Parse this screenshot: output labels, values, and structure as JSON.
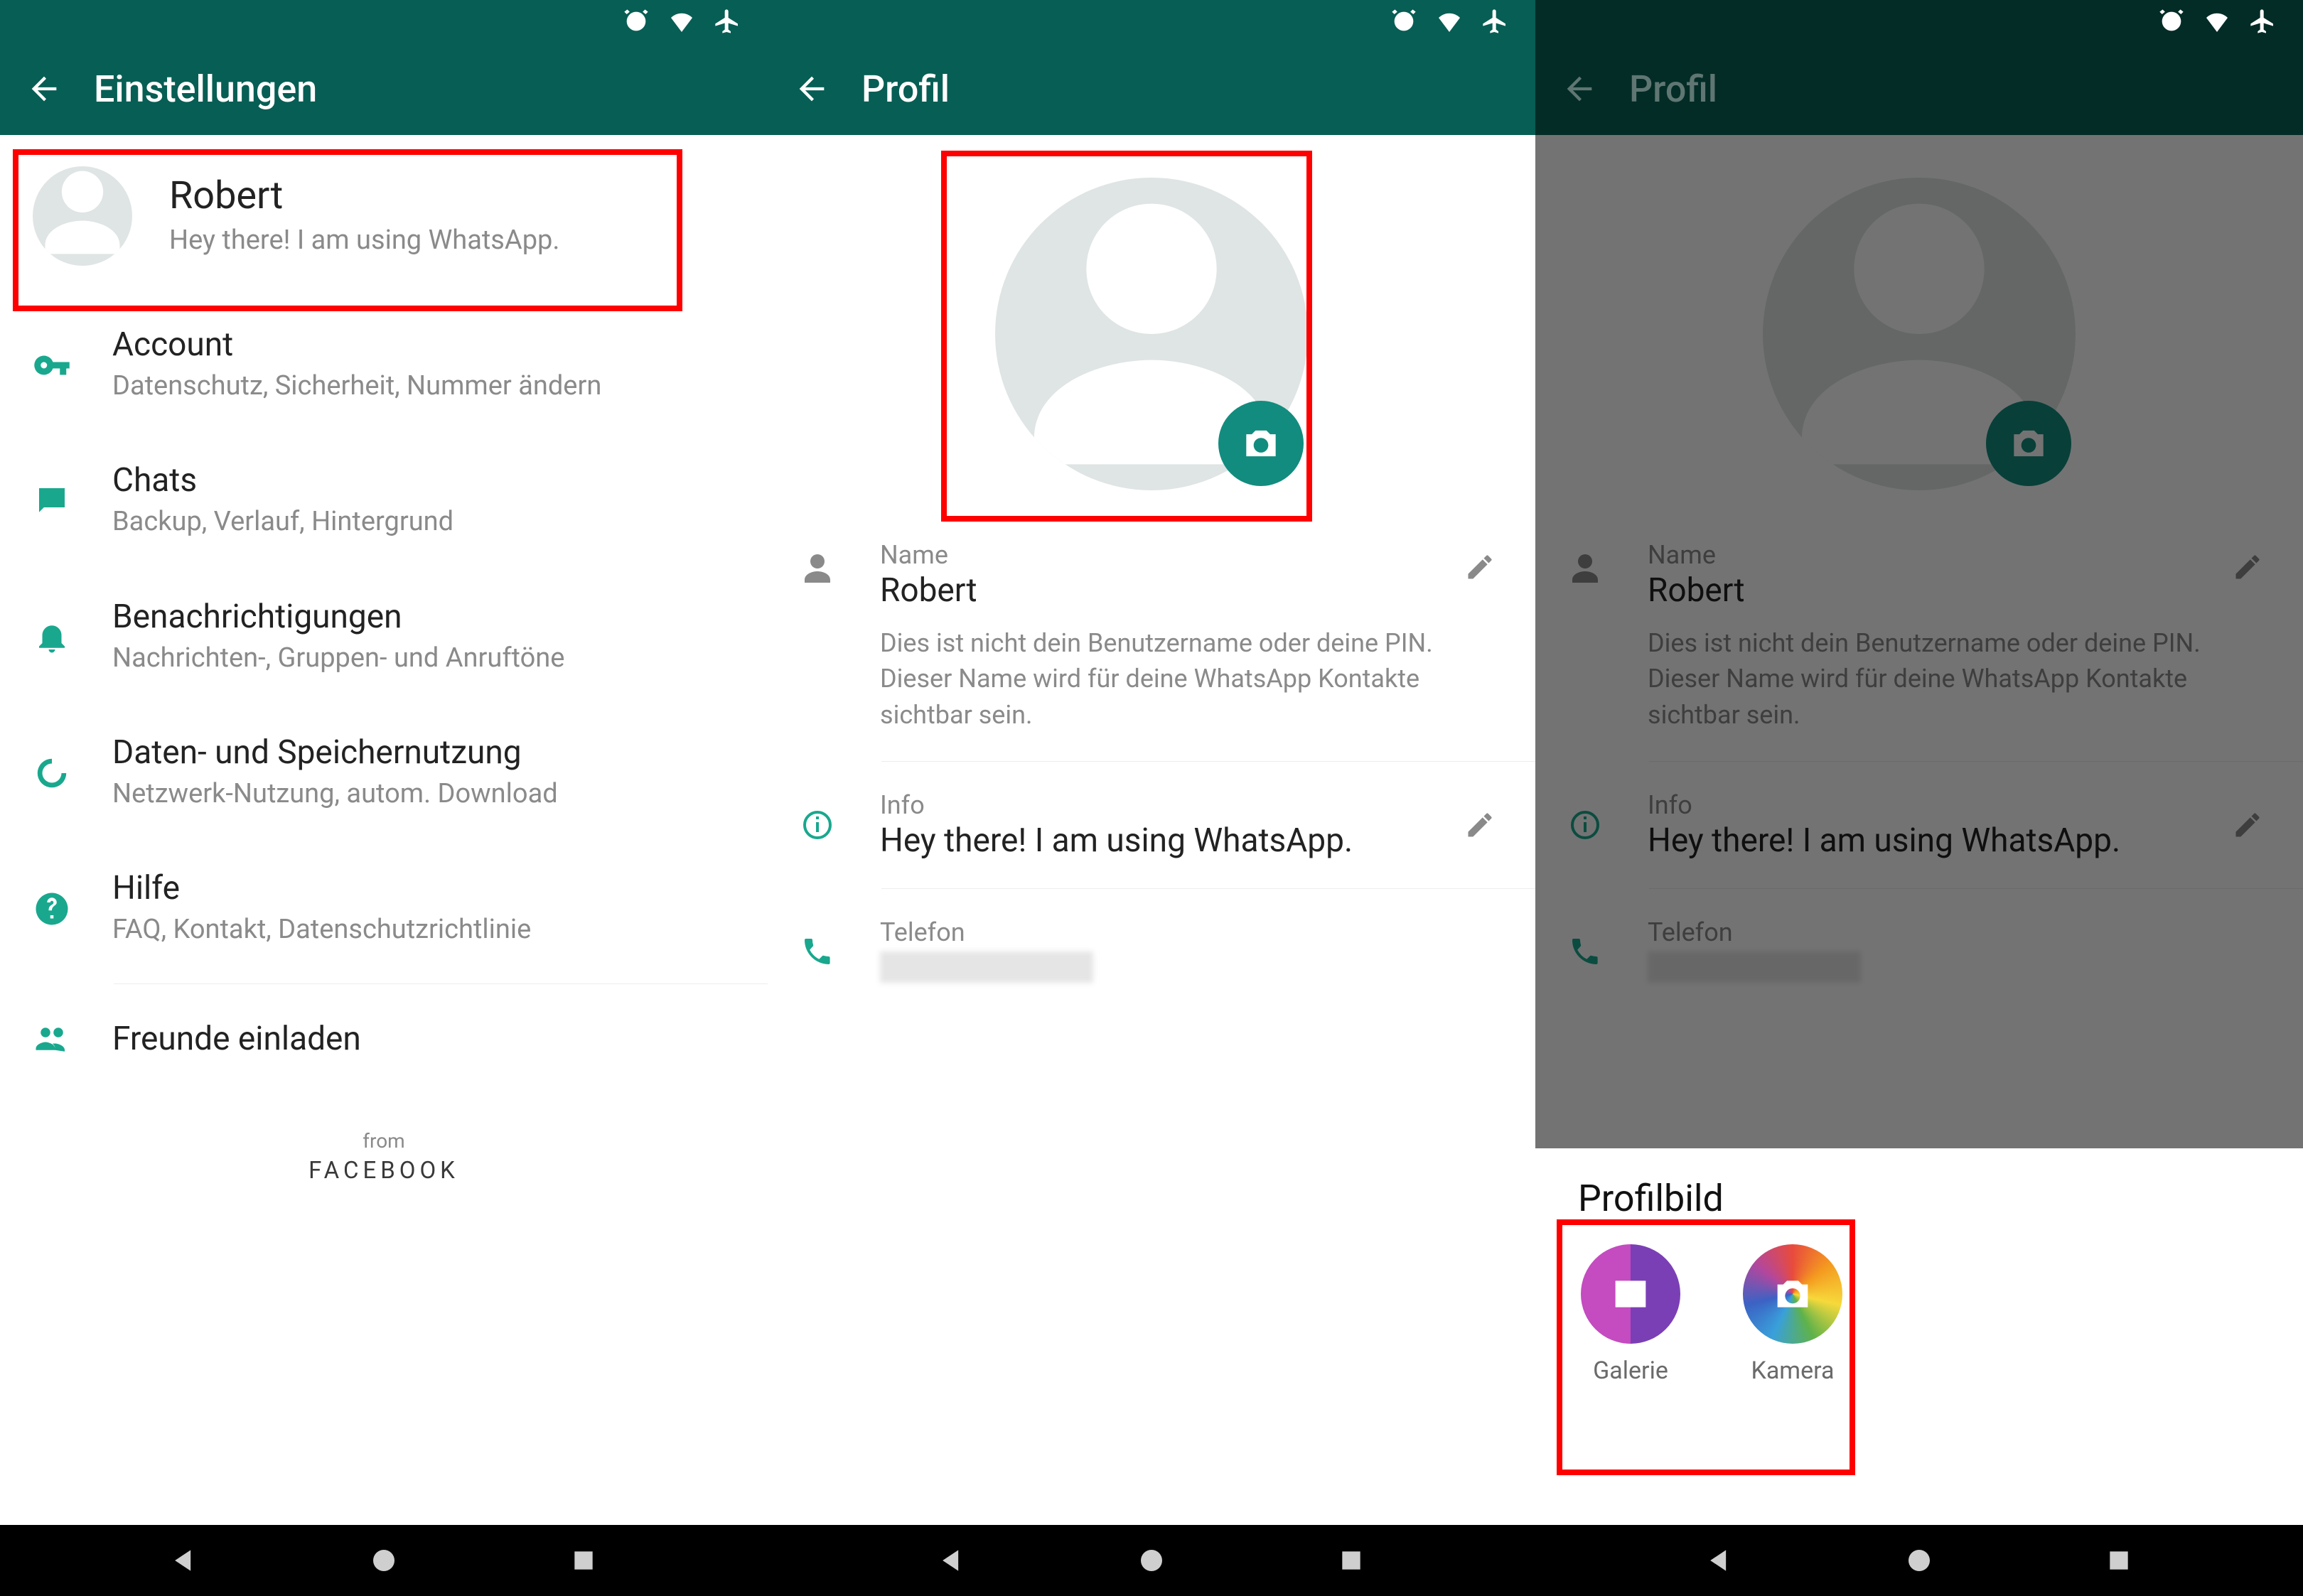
{
  "s1": {
    "title": "Einstellungen",
    "profile": {
      "name": "Robert",
      "status": "Hey there! I am using WhatsApp."
    },
    "items": {
      "account": {
        "title": "Account",
        "sub": "Datenschutz, Sicherheit, Nummer ändern"
      },
      "chats": {
        "title": "Chats",
        "sub": "Backup, Verlauf, Hintergrund"
      },
      "notif": {
        "title": "Benachrichtigungen",
        "sub": "Nachrichten-, Gruppen- und Anruftöne"
      },
      "data": {
        "title": "Daten- und Speichernutzung",
        "sub": "Netzwerk-Nutzung, autom. Download"
      },
      "help": {
        "title": "Hilfe",
        "sub": "FAQ, Kontakt, Datenschutzrichtlinie"
      },
      "invite": {
        "title": "Freunde einladen"
      }
    },
    "footer": {
      "from": "from",
      "brand": "FACEBOOK"
    }
  },
  "s2": {
    "title": "Profil",
    "name_label": "Name",
    "name_value": "Robert",
    "name_desc": "Dies ist nicht dein Benutzername oder deine PIN. Dieser Name wird für deine WhatsApp Kontakte sichtbar sein.",
    "info_label": "Info",
    "info_value": "Hey there! I am using WhatsApp.",
    "phone_label": "Telefon"
  },
  "s3": {
    "title": "Profil",
    "sheet_title": "Profilbild",
    "gallery": "Galerie",
    "camera": "Kamera"
  }
}
